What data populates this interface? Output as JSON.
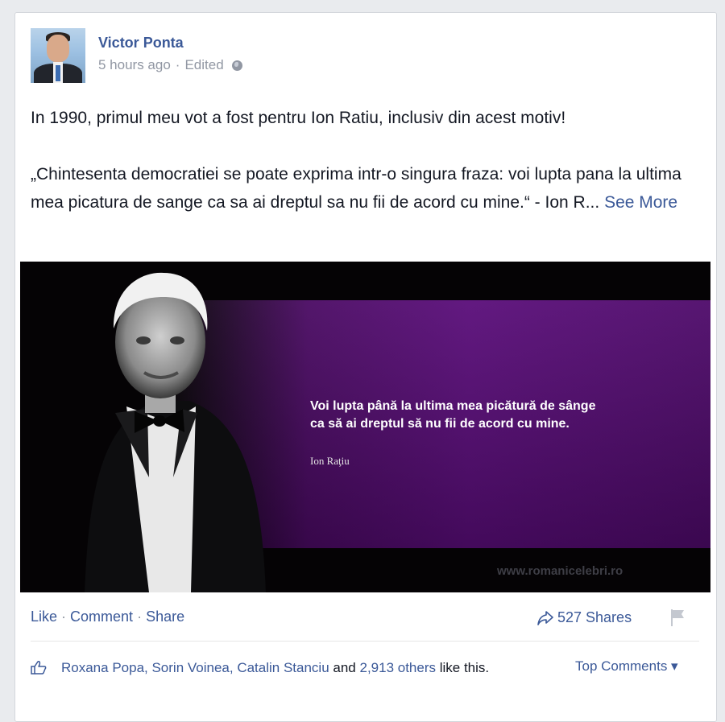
{
  "post": {
    "author": "Victor Ponta",
    "time": "5 hours ago",
    "edited": "Edited",
    "text_line1": "In 1990, primul meu vot a fost pentru Ion Ratiu, inclusiv din acest motiv!",
    "text_quote": "„Chintesenta democratiei se poate exprima intr-o singura fraza: voi lupta pana la ultima mea picatura de sange ca sa ai dreptul sa nu fii de acord cu mine.“ - Ion R...",
    "see_more": "See More"
  },
  "image": {
    "quote_line1": "Voi lupta până la ultima mea picătură de sânge",
    "quote_line2": "ca să ai dreptul să nu fii de acord cu mine.",
    "quote_author": "Ion Raţiu",
    "watermark": "www.romanicelebri.ro",
    "colors": {
      "band": "#5a0d7a",
      "background": "#050305"
    }
  },
  "actions": {
    "like": "Like",
    "comment": "Comment",
    "share": "Share",
    "separator": " · ",
    "shares_count": "527 Shares"
  },
  "likes": {
    "names": "Roxana Popa, Sorin Voinea, Catalin Stanciu",
    "and": " and ",
    "others": "2,913 others",
    "suffix": " like this."
  },
  "comments_sort": "Top Comments ▾",
  "colors": {
    "link": "#3b5998",
    "meta": "#9197a3"
  }
}
